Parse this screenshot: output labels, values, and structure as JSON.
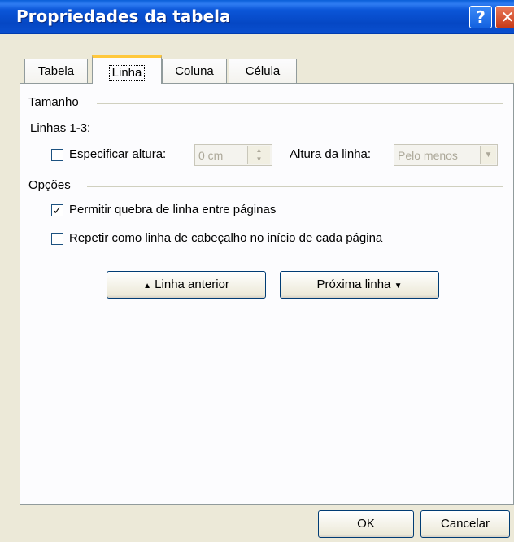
{
  "window": {
    "title": "Propriedades da tabela",
    "help_glyph": "?",
    "close_glyph": "✕"
  },
  "tabs": [
    {
      "label": "Tabela",
      "active": false
    },
    {
      "label": "Linha",
      "active": true
    },
    {
      "label": "Coluna",
      "active": false
    },
    {
      "label": "Célula",
      "active": false
    }
  ],
  "size_group": {
    "title": "Tamanho",
    "rows_label": "Linhas 1-3:",
    "specify_height": {
      "label": "Especificar altura:",
      "checked": false
    },
    "height_value": "0 cm",
    "row_height_label": "Altura da linha:",
    "row_height_value": "Pelo menos"
  },
  "options_group": {
    "title": "Opções",
    "allow_break": {
      "label": "Permitir quebra de linha entre páginas",
      "checked": true,
      "check_glyph": "✓"
    },
    "repeat_header": {
      "label": "Repetir como linha de cabeçalho no início de cada página",
      "checked": false
    }
  },
  "nav": {
    "prev_label": "Linha anterior",
    "prev_icon": "▲",
    "next_label": "Próxima linha",
    "next_icon": "▼"
  },
  "footer": {
    "ok_label": "OK",
    "cancel_label": "Cancelar"
  },
  "colors": {
    "titlebar": "#0547c4",
    "dialog_bg": "#ece9d8",
    "active_tab_accent": "#ffc83c"
  }
}
